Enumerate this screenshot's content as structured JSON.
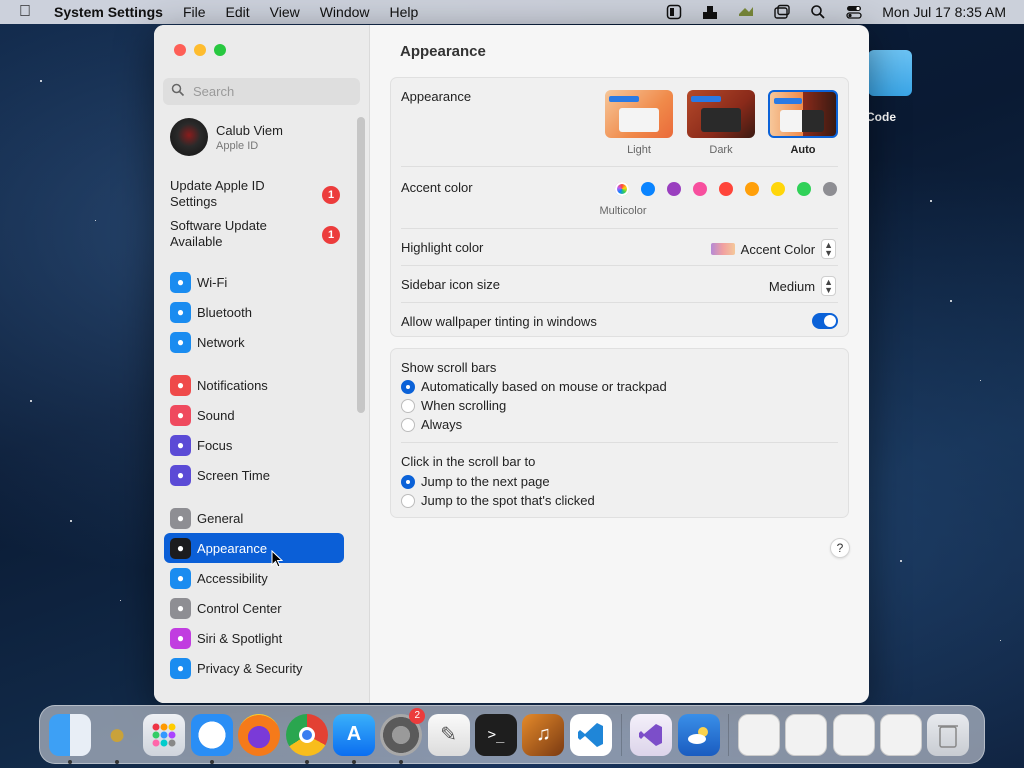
{
  "menubar": {
    "app_name": "System Settings",
    "menus": [
      "File",
      "Edit",
      "View",
      "Window",
      "Help"
    ],
    "clock": "Mon Jul 17  8:35 AM"
  },
  "desktop": {
    "folder_label": "Code"
  },
  "window": {
    "search_placeholder": "Search",
    "account": {
      "name": "Calub Viem",
      "subtitle": "Apple ID"
    },
    "notices": [
      {
        "label": "Update Apple ID Settings",
        "badge": "1"
      },
      {
        "label": "Software Update Available",
        "badge": "1"
      }
    ],
    "sidebar_items": [
      {
        "label": "Wi-Fi",
        "icon": "wifi-icon",
        "color": "#1a8cf0"
      },
      {
        "label": "Bluetooth",
        "icon": "bluetooth-icon",
        "color": "#1a8cf0"
      },
      {
        "label": "Network",
        "icon": "globe-icon",
        "color": "#1a8cf0"
      },
      {
        "label": "Notifications",
        "icon": "bell-icon",
        "color": "#ef4a4a"
      },
      {
        "label": "Sound",
        "icon": "speaker-icon",
        "color": "#ef4a5e"
      },
      {
        "label": "Focus",
        "icon": "moon-icon",
        "color": "#5b4bd6"
      },
      {
        "label": "Screen Time",
        "icon": "hourglass-icon",
        "color": "#5b4bd6"
      },
      {
        "label": "General",
        "icon": "gear-icon",
        "color": "#8e8e93"
      },
      {
        "label": "Appearance",
        "icon": "appearance-icon",
        "color": "#1c1c1e"
      },
      {
        "label": "Accessibility",
        "icon": "accessibility-icon",
        "color": "#1a8cf0"
      },
      {
        "label": "Control Center",
        "icon": "control-center-icon",
        "color": "#8e8e93"
      },
      {
        "label": "Siri & Spotlight",
        "icon": "siri-icon",
        "color": "#c13de0"
      },
      {
        "label": "Privacy & Security",
        "icon": "hand-icon",
        "color": "#1a8cf0"
      }
    ],
    "selected_item": "Appearance",
    "content": {
      "title": "Appearance",
      "appearance": {
        "label": "Appearance",
        "options": [
          "Light",
          "Dark",
          "Auto"
        ],
        "selected": "Auto"
      },
      "accent": {
        "label": "Accent color",
        "colors": [
          "#a0a0a0",
          "#0a84ff",
          "#9a3fbf",
          "#f74f9e",
          "#ff453a",
          "#ff9f0a",
          "#ffd60a",
          "#30d158",
          "#8e8e93"
        ],
        "selected_name": "Multicolor"
      },
      "highlight": {
        "label": "Highlight color",
        "value": "Accent Color"
      },
      "icon_size": {
        "label": "Sidebar icon size",
        "value": "Medium"
      },
      "tinting": {
        "label": "Allow wallpaper tinting in windows",
        "enabled": true
      },
      "scroll_bars": {
        "label": "Show scroll bars",
        "options": [
          "Automatically based on mouse or trackpad",
          "When scrolling",
          "Always"
        ],
        "selected": "Automatically based on mouse or trackpad"
      },
      "click_scroll": {
        "label": "Click in the scroll bar to",
        "options": [
          "Jump to the next page",
          "Jump to the spot that's clicked"
        ],
        "selected": "Jump to the next page"
      },
      "help": "?"
    }
  },
  "dock": {
    "settings_badge": "2",
    "apps": [
      "finder-icon",
      "bee-icon",
      "launchpad-icon",
      "safari-icon",
      "firefox-icon",
      "chrome-icon",
      "app-store-icon",
      "system-settings-icon",
      "textedit-icon",
      "terminal-icon",
      "instruments-icon",
      "vscode-icon",
      "visual-studio-icon",
      "weather-icon"
    ]
  }
}
